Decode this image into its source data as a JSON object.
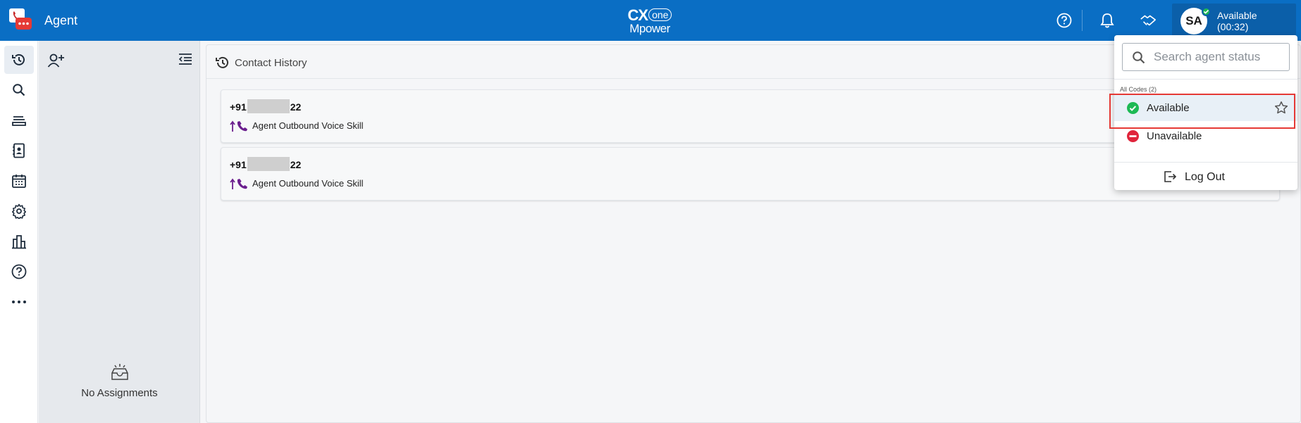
{
  "header": {
    "app_title": "Agent",
    "brand_top": "CX",
    "brand_one": "one",
    "brand_bottom": "Mpower",
    "icons": [
      "help-icon",
      "bell-icon",
      "handshake-icon"
    ],
    "avatar_initials": "SA",
    "status_label": "Available",
    "status_timer": "(00:32)"
  },
  "left_nav": {
    "items": [
      "history-icon",
      "search-icon",
      "queue-icon",
      "contacts-book-icon",
      "calendar-icon",
      "settings-icon",
      "reports-icon",
      "help-icon",
      "more-icon"
    ],
    "active": "history-icon"
  },
  "assignments": {
    "empty_text": "No Assignments"
  },
  "main": {
    "title": "Contact History",
    "contacts": [
      {
        "number_prefix": "+91",
        "number_suffix": "22",
        "skill": "Agent Outbound Voice Skill",
        "direction": "outbound"
      },
      {
        "number_prefix": "+91",
        "number_suffix": "22",
        "skill": "Agent Outbound Voice Skill",
        "direction": "outbound"
      }
    ]
  },
  "status_menu": {
    "search_placeholder": "Search agent status",
    "codes_label": "All Codes (2)",
    "options": [
      {
        "label": "Available",
        "color": "#1db954",
        "selected": true
      },
      {
        "label": "Unavailable",
        "color": "#e0243b",
        "selected": false
      }
    ],
    "logout_label": "Log Out"
  },
  "colors": {
    "header_bg": "#0a6ec4",
    "available": "#1db954",
    "unavailable": "#e0243b",
    "highlight": "#e53935"
  }
}
